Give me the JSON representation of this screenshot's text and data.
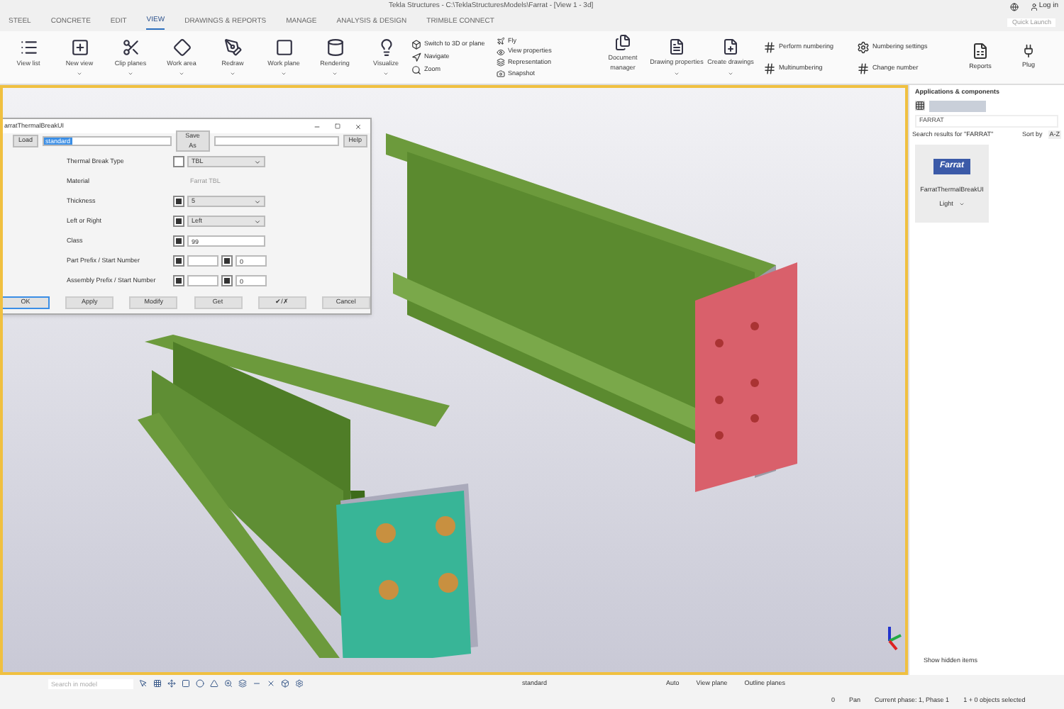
{
  "window": {
    "title": "Tekla Structures - C:\\TeklaStructuresModels\\Farrat - [View 1 - 3d]",
    "quick_launch": {
      "placeholder": "Quick Launch"
    },
    "user": "Log in"
  },
  "tabs": [
    {
      "label": "STEEL",
      "selected": false
    },
    {
      "label": "CONCRETE",
      "selected": false
    },
    {
      "label": "EDIT",
      "selected": false
    },
    {
      "label": "VIEW",
      "selected": true
    },
    {
      "label": "DRAWINGS & REPORTS",
      "selected": false
    },
    {
      "label": "MANAGE",
      "selected": false
    },
    {
      "label": "ANALYSIS & DESIGN",
      "selected": false
    },
    {
      "label": "TRIMBLE CONNECT",
      "selected": false
    }
  ],
  "ribbon": {
    "large": [
      {
        "label": "View list",
        "dropdown": false
      },
      {
        "label": "New view",
        "dropdown": true
      },
      {
        "label": "Clip planes",
        "dropdown": true
      },
      {
        "label": "Work area",
        "dropdown": true
      },
      {
        "label": "Redraw",
        "dropdown": true
      },
      {
        "label": "Work plane",
        "dropdown": true
      },
      {
        "label": "Rendering",
        "dropdown": true
      },
      {
        "label": "Visualize",
        "dropdown": true
      }
    ],
    "small_1": [
      "Switch to 3D or plane",
      "Navigate",
      "Zoom"
    ],
    "small_2": [
      "Fly",
      "View properties",
      "Representation",
      "Snapshot"
    ],
    "large_2": [
      {
        "label": "Document manager",
        "dropdown": false
      },
      {
        "label": "Drawing properties",
        "dropdown": true
      },
      {
        "label": "Create drawings",
        "dropdown": true
      }
    ],
    "numbering": [
      "Perform numbering",
      "Multinumbering"
    ],
    "numbering_2": [
      "Numbering settings",
      "Change number"
    ],
    "reports": "Reports",
    "plugins": "Plug"
  },
  "dialog": {
    "title": "arratThermalBreakUI",
    "load": "Load",
    "preset": "standard",
    "save_as": "Save As",
    "help": "Help",
    "rows": [
      {
        "label": "Thermal Break Type",
        "kind": "select",
        "checked": false,
        "value": "TBL"
      },
      {
        "label": "Material",
        "kind": "readonly",
        "value": "Farrat TBL"
      },
      {
        "label": "Thickness",
        "kind": "select",
        "checked": true,
        "value": "5"
      },
      {
        "label": "Left or Right",
        "kind": "select",
        "checked": true,
        "value": "Left"
      },
      {
        "label": "Class",
        "kind": "text",
        "checked": true,
        "value": "99"
      },
      {
        "label": "Part Prefix / Start Number",
        "kind": "pair",
        "checked": true,
        "checked_2": true,
        "value_2": "0"
      },
      {
        "label": "Assembly Prefix / Start Number",
        "kind": "pair",
        "checked": true,
        "checked_2": true,
        "value_2": "0"
      }
    ],
    "buttons": [
      "OK",
      "Apply",
      "Modify",
      "Get",
      "✔/✗",
      "Cancel"
    ]
  },
  "panel": {
    "title": "Applications & components",
    "filter": "FARRAT",
    "results": "Search results for \"FARRAT\"",
    "sort_label": "Sort by",
    "sort_value": "A-Z",
    "tile": {
      "logo": "Farrat",
      "name": "FarratThermalBreakUI",
      "variant": "Light"
    },
    "show_hidden": "Show hidden items"
  },
  "bottom": {
    "search": {
      "placeholder": "Search in model"
    },
    "standard": "standard",
    "snap": "Auto",
    "view_plane": "View plane",
    "outline": "Outline planes",
    "count": "0",
    "mode": "Pan",
    "phase": "Current phase: 1, Phase 1",
    "selection": "1 + 0 objects selected"
  }
}
